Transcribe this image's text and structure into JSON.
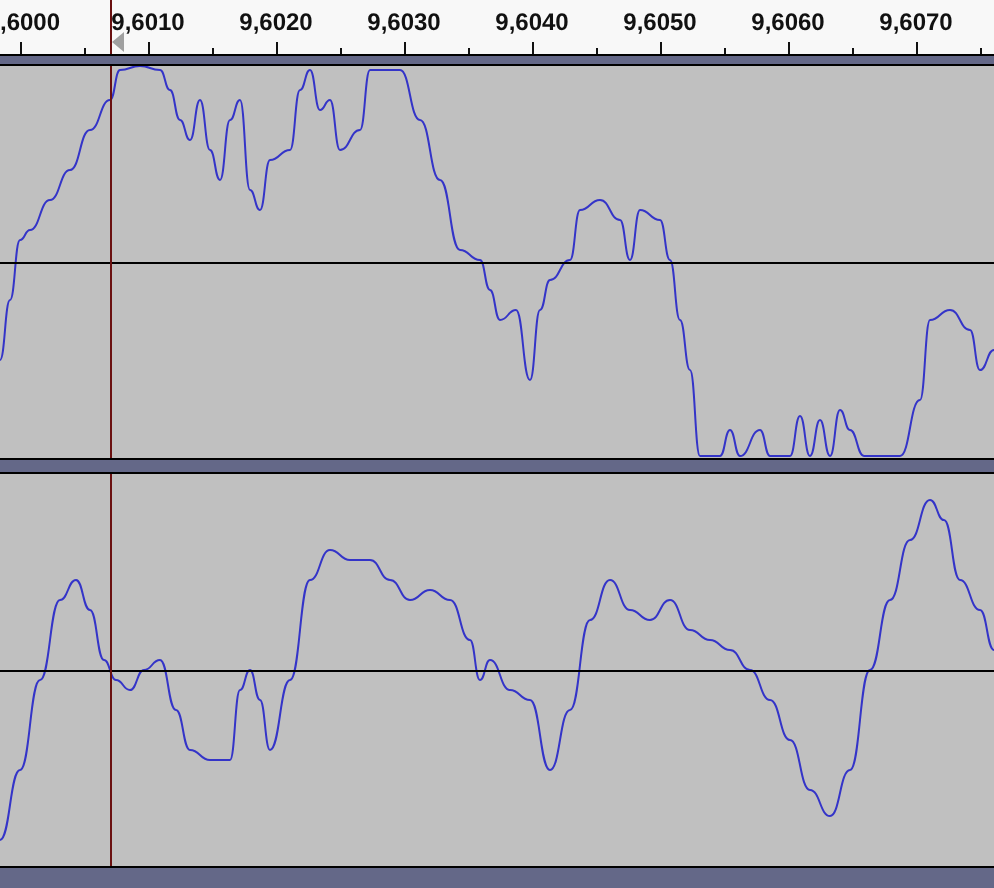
{
  "ruler": {
    "ticks": [
      ",6000",
      "9,6010",
      "9,6020",
      "9,6030",
      "9,6040",
      "9,6050",
      "9,6060",
      "9,6070"
    ]
  },
  "tracks": [
    {
      "kind": "waveform"
    },
    {
      "kind": "waveform"
    }
  ]
}
